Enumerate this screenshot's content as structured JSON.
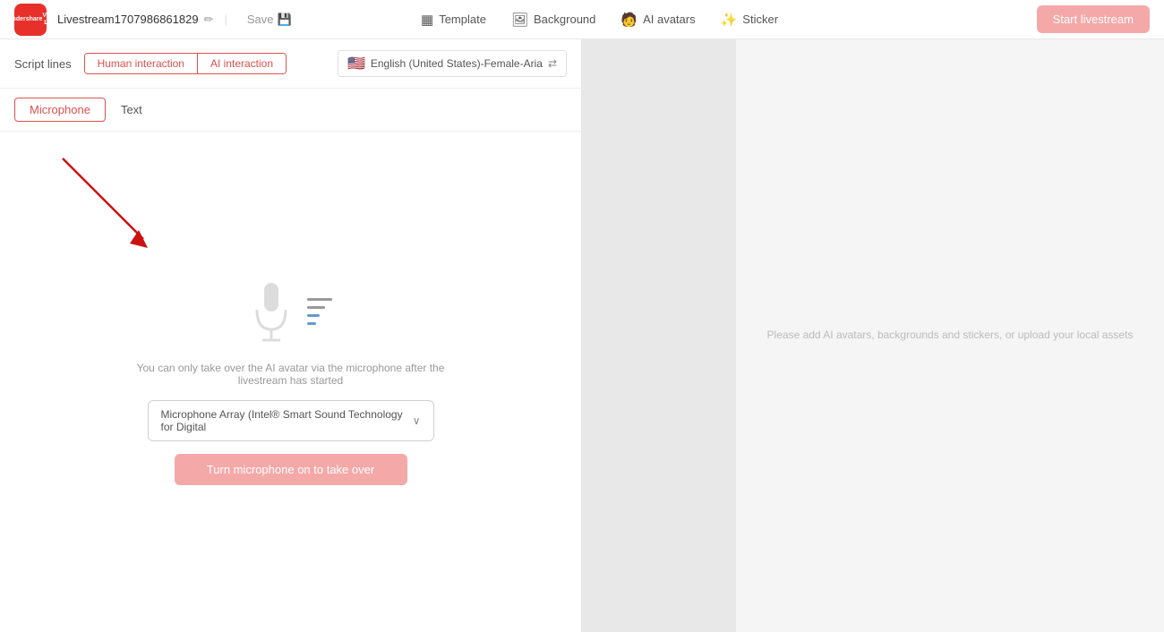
{
  "header": {
    "logo_line1": "Wondershare",
    "logo_line2": "Virbo Live",
    "stream_name": "Livestream1707986861829",
    "edit_icon": "✏",
    "save_label": "Save",
    "save_icon": "💾",
    "nav_items": [
      {
        "icon": "▦",
        "label": "Template"
      },
      {
        "icon": "🖼",
        "label": "Background"
      },
      {
        "icon": "🧑",
        "label": "AI avatars"
      },
      {
        "icon": "✨",
        "label": "Sticker"
      }
    ],
    "start_button": "Start livestream"
  },
  "script_bar": {
    "label": "Script lines",
    "tabs": [
      {
        "label": "Human interaction",
        "active": true
      },
      {
        "label": "AI interaction",
        "active": false
      }
    ],
    "language": "English (United States)-Female-Aria",
    "flag": "🇺🇸"
  },
  "sub_tabs": [
    {
      "label": "Microphone",
      "active": true
    },
    {
      "label": "Text",
      "active": false
    }
  ],
  "content": {
    "mic_hint": "You can only take over the AI avatar via the microphone after the livestream has started",
    "mic_dropdown_value": "Microphone Array (Intel® Smart Sound Technology for Digital",
    "takeover_button": "Turn microphone on to take over"
  },
  "right_panel": {
    "placeholder_text": "Please add AI avatars, backgrounds and stickers, or upload your local assets"
  }
}
